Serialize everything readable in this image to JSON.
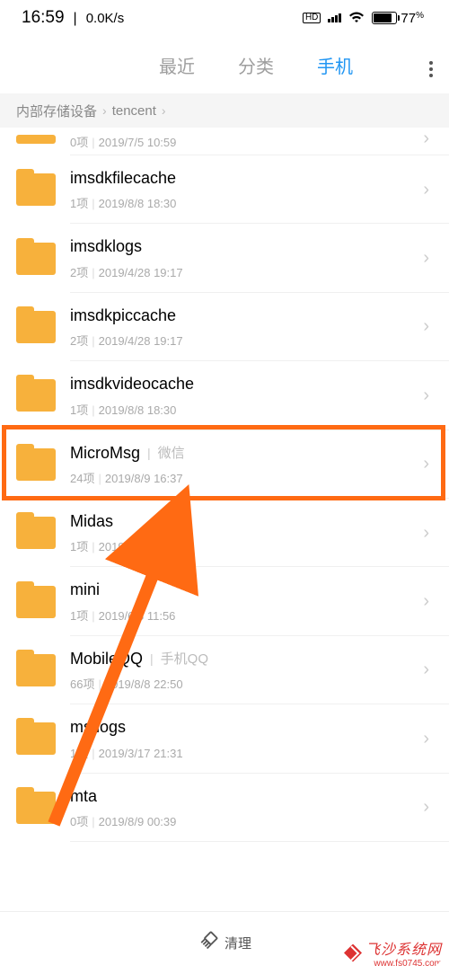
{
  "statusbar": {
    "time": "16:59",
    "netspeed": "0.0K/s",
    "hd": "HD",
    "battery_pct": "77"
  },
  "tabs": {
    "recent": "最近",
    "category": "分类",
    "phone": "手机"
  },
  "breadcrumb": {
    "root": "内部存储设备",
    "path1": "tencent"
  },
  "folders": [
    {
      "name": "",
      "alias": "",
      "count": "0项",
      "date": "2019/7/5 10:59",
      "partial": true
    },
    {
      "name": "imsdkfilecache",
      "alias": "",
      "count": "1项",
      "date": "2019/8/8 18:30"
    },
    {
      "name": "imsdklogs",
      "alias": "",
      "count": "2项",
      "date": "2019/4/28 19:17"
    },
    {
      "name": "imsdkpiccache",
      "alias": "",
      "count": "2项",
      "date": "2019/4/28 19:17"
    },
    {
      "name": "imsdkvideocache",
      "alias": "",
      "count": "1项",
      "date": "2019/8/8 18:30"
    },
    {
      "name": "MicroMsg",
      "alias": "微信",
      "count": "24项",
      "date": "2019/8/9 16:37",
      "highlighted": true
    },
    {
      "name": "Midas",
      "alias": "",
      "count": "1项",
      "date": "2019/8/8 22:14",
      "obscured": true
    },
    {
      "name": "mini",
      "alias": "",
      "count": "1项",
      "date": "2019/6/8 11:56"
    },
    {
      "name": "MobileQQ",
      "alias": "手机QQ",
      "count": "66项",
      "date": "2019/8/8 22:50"
    },
    {
      "name": "msflogs",
      "alias": "",
      "count": "1项",
      "date": "2019/3/17 21:31"
    },
    {
      "name": "mta",
      "alias": "",
      "count": "0项",
      "date": "2019/8/9 00:39"
    }
  ],
  "bottombar": {
    "clean": "清理"
  },
  "watermark": {
    "text": "飞沙系统网",
    "url": "www.fs0745.com"
  },
  "annotation": {
    "highlight_color": "#ff6a13",
    "arrow_color": "#ff6a13"
  }
}
